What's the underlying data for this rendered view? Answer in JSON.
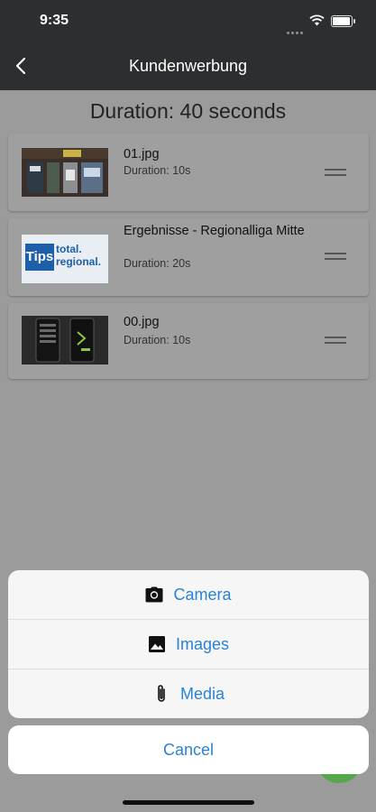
{
  "status": {
    "time": "9:35"
  },
  "nav": {
    "title": "Kundenwerbung"
  },
  "playlist": {
    "duration": "Duration: 40 seconds",
    "items": [
      {
        "title": "01.jpg",
        "duration": "Duration: 10s"
      },
      {
        "title": "Ergebnisse - Regionalliga Mitte",
        "duration": "Duration: 20s"
      },
      {
        "title": "00.jpg",
        "duration": "Duration: 10s"
      }
    ]
  },
  "thumb2": {
    "tips": "Tips",
    "line1": "total.",
    "line2": "regional."
  },
  "sheet": {
    "camera": "Camera",
    "images": "Images",
    "media": "Media",
    "cancel": "Cancel"
  },
  "colors": {
    "accent": "#2a82d6",
    "navbar": "#2b2f2f",
    "fab": "#55a84a"
  }
}
